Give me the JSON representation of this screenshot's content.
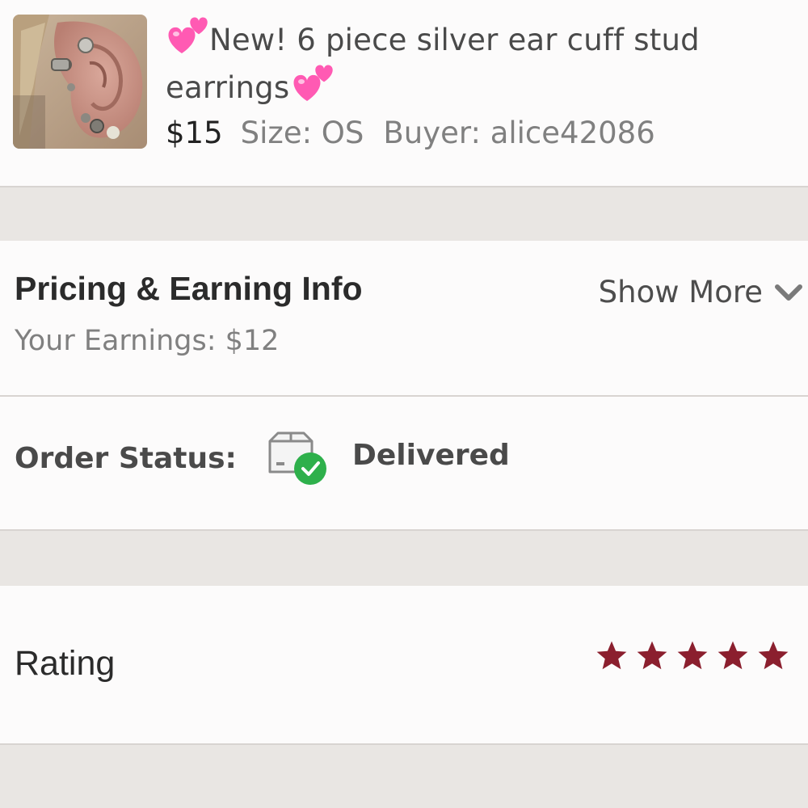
{
  "item": {
    "title_line1": "New! 6 piece silver ear cuff stud",
    "title_line2": "earrings",
    "price": "$15",
    "size": "Size: OS",
    "buyer": "Buyer: alice42086",
    "thumbnail_icon": "ear-cuff-photo"
  },
  "pricing": {
    "title": "Pricing & Earning Info",
    "show_more": "Show More",
    "earnings": "Your Earnings: $12"
  },
  "order_status": {
    "label": "Order Status:",
    "value": "Delivered",
    "icon": "package-delivered-icon",
    "icon_color": "#2eb04b"
  },
  "rating": {
    "label": "Rating",
    "stars": 5,
    "max_stars": 5,
    "star_color": "#8b1f2e"
  }
}
